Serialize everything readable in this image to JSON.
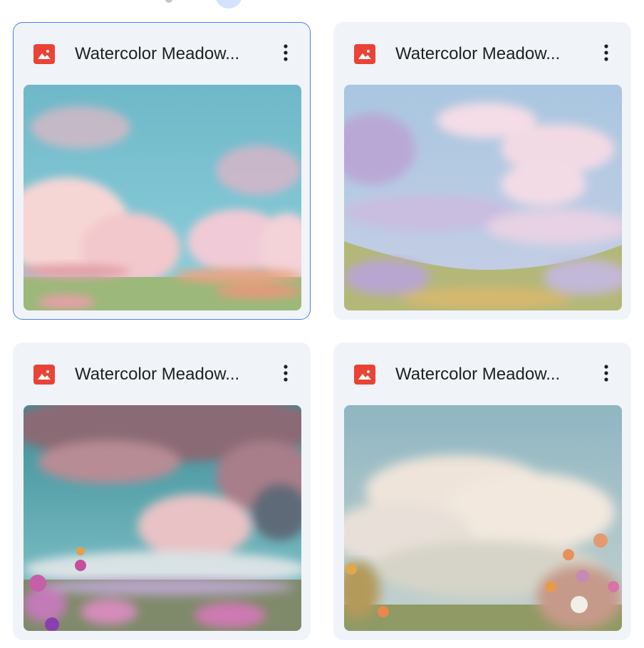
{
  "colors": {
    "card_bg": "#f0f4f9",
    "selected_border": "#4f7de9",
    "image_icon": "#ea4335",
    "title_text": "#1f1f1f"
  },
  "files": [
    {
      "title": "Watercolor Meadow...",
      "icon": "image-file-icon",
      "selected": true
    },
    {
      "title": "Watercolor Meadow...",
      "icon": "image-file-icon",
      "selected": false
    },
    {
      "title": "Watercolor Meadow...",
      "icon": "image-file-icon",
      "selected": false
    },
    {
      "title": "Watercolor Meadow...",
      "icon": "image-file-icon",
      "selected": false
    }
  ]
}
